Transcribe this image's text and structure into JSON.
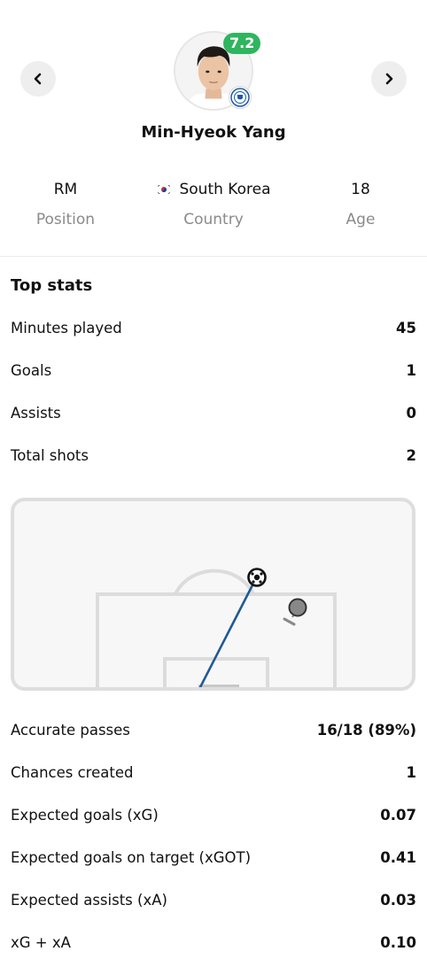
{
  "player": {
    "name": "Min-Hyeok Yang",
    "rating": "7.2",
    "position": "RM",
    "country": "South Korea",
    "age": "18"
  },
  "labels": {
    "position": "Position",
    "country": "Country",
    "age": "Age"
  },
  "top_stats": {
    "title": "Top stats",
    "rows": [
      {
        "label": "Minutes played",
        "value": "45"
      },
      {
        "label": "Goals",
        "value": "1"
      },
      {
        "label": "Assists",
        "value": "0"
      },
      {
        "label": "Total shots",
        "value": "2"
      }
    ]
  },
  "more_stats": {
    "rows": [
      {
        "label": "Accurate passes",
        "value": "16/18 (89%)"
      },
      {
        "label": "Chances created",
        "value": "1"
      },
      {
        "label": "Expected goals (xG)",
        "value": "0.07"
      },
      {
        "label": "Expected goals on target (xGOT)",
        "value": "0.41"
      },
      {
        "label": "Expected assists (xA)",
        "value": "0.03"
      },
      {
        "label": "xG + xA",
        "value": "0.10"
      }
    ]
  },
  "colors": {
    "rating_badge": "#2fb55e",
    "goal_line": "#1f5a94",
    "pitch_lines": "#dcdcdc",
    "miss_marker": "#888888"
  },
  "icons": {
    "prev": "chevron-left-icon",
    "next": "chevron-right-icon",
    "club": "club-crest-icon",
    "flag": "south-korea-flag-icon",
    "goal_marker": "soccer-ball-icon"
  }
}
